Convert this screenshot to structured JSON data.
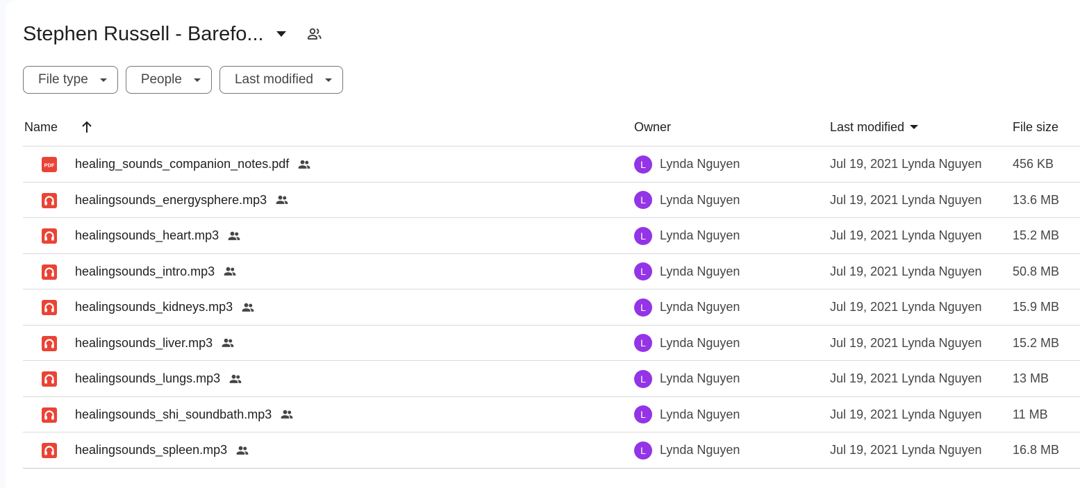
{
  "folder": {
    "title": "Stephen Russell - Barefo...",
    "title_caret_icon": "caret-down-icon",
    "shared_icon": "people-icon"
  },
  "filters": [
    {
      "label": "File type",
      "icon": "caret-down-icon"
    },
    {
      "label": "People",
      "icon": "caret-down-icon"
    },
    {
      "label": "Last modified",
      "icon": "caret-down-icon"
    }
  ],
  "columns": {
    "name": "Name",
    "name_sort_icon": "arrow-up-icon",
    "owner": "Owner",
    "last_modified": "Last modified",
    "last_modified_icon": "caret-down-icon",
    "file_size": "File size"
  },
  "files": [
    {
      "name": "healing_sounds_companion_notes.pdf",
      "type": "pdf",
      "type_label": "PDF",
      "owner": "Lynda Nguyen",
      "owner_initial": "L",
      "modified_date": "Jul 19, 2021",
      "modified_by": "Lynda Nguyen",
      "size": "456 KB"
    },
    {
      "name": "healingsounds_energysphere.mp3",
      "type": "audio",
      "owner": "Lynda Nguyen",
      "owner_initial": "L",
      "modified_date": "Jul 19, 2021",
      "modified_by": "Lynda Nguyen",
      "size": "13.6 MB"
    },
    {
      "name": "healingsounds_heart.mp3",
      "type": "audio",
      "owner": "Lynda Nguyen",
      "owner_initial": "L",
      "modified_date": "Jul 19, 2021",
      "modified_by": "Lynda Nguyen",
      "size": "15.2 MB"
    },
    {
      "name": "healingsounds_intro.mp3",
      "type": "audio",
      "owner": "Lynda Nguyen",
      "owner_initial": "L",
      "modified_date": "Jul 19, 2021",
      "modified_by": "Lynda Nguyen",
      "size": "50.8 MB"
    },
    {
      "name": "healingsounds_kidneys.mp3",
      "type": "audio",
      "owner": "Lynda Nguyen",
      "owner_initial": "L",
      "modified_date": "Jul 19, 2021",
      "modified_by": "Lynda Nguyen",
      "size": "15.9 MB"
    },
    {
      "name": "healingsounds_liver.mp3",
      "type": "audio",
      "owner": "Lynda Nguyen",
      "owner_initial": "L",
      "modified_date": "Jul 19, 2021",
      "modified_by": "Lynda Nguyen",
      "size": "15.2 MB"
    },
    {
      "name": "healingsounds_lungs.mp3",
      "type": "audio",
      "owner": "Lynda Nguyen",
      "owner_initial": "L",
      "modified_date": "Jul 19, 2021",
      "modified_by": "Lynda Nguyen",
      "size": "13 MB"
    },
    {
      "name": "healingsounds_shi_soundbath.mp3",
      "type": "audio",
      "owner": "Lynda Nguyen",
      "owner_initial": "L",
      "modified_date": "Jul 19, 2021",
      "modified_by": "Lynda Nguyen",
      "size": "11 MB"
    },
    {
      "name": "healingsounds_spleen.mp3",
      "type": "audio",
      "owner": "Lynda Nguyen",
      "owner_initial": "L",
      "modified_date": "Jul 19, 2021",
      "modified_by": "Lynda Nguyen",
      "size": "16.8 MB"
    }
  ],
  "colors": {
    "file_icon_red": "#ea4335",
    "avatar_purple": "#9334e6",
    "text_primary": "#1f1f1f",
    "text_secondary": "#444746",
    "divider": "#d9d9d9"
  }
}
